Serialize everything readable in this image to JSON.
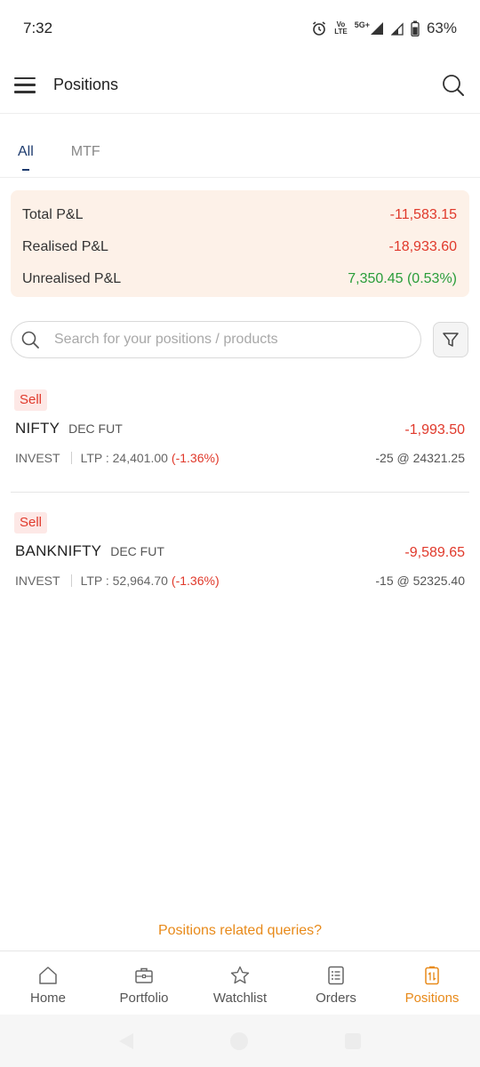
{
  "status_bar": {
    "time": "7:32",
    "network_top": "Vo",
    "network_bottom": "LTE",
    "network_type": "5G+",
    "battery": "63%"
  },
  "header": {
    "title": "Positions"
  },
  "tabs": [
    {
      "label": "All",
      "active": true
    },
    {
      "label": "MTF",
      "active": false
    }
  ],
  "pnl_summary": {
    "total_label": "Total P&L",
    "total_value": "-11,583.15",
    "realised_label": "Realised P&L",
    "realised_value": "-18,933.60",
    "unrealised_label": "Unrealised P&L",
    "unrealised_value": "7,350.45 (0.53%)"
  },
  "search": {
    "placeholder": "Search for your positions / products"
  },
  "positions": [
    {
      "side": "Sell",
      "symbol": "NIFTY",
      "expiry": "DEC FUT",
      "pnl": "-1,993.50",
      "product": "INVEST",
      "ltp": "LTP : 24,401.00",
      "change": "(-1.36%)",
      "qty_price": "-25 @ 24321.25"
    },
    {
      "side": "Sell",
      "symbol": "BANKNIFTY",
      "expiry": "DEC FUT",
      "pnl": "-9,589.65",
      "product": "INVEST",
      "ltp": "LTP : 52,964.70",
      "change": "(-1.36%)",
      "qty_price": "-15 @ 52325.40"
    }
  ],
  "queries_link": "Positions related queries?",
  "bottom_nav": [
    {
      "label": "Home",
      "icon": "home-icon"
    },
    {
      "label": "Portfolio",
      "icon": "briefcase-icon"
    },
    {
      "label": "Watchlist",
      "icon": "star-icon"
    },
    {
      "label": "Orders",
      "icon": "orders-list-icon"
    },
    {
      "label": "Positions",
      "icon": "positions-icon",
      "active": true
    }
  ],
  "colors": {
    "accent": "#e88a1a",
    "negative": "#e0392b",
    "positive": "#2a9d3a",
    "tab_active": "#1d3b6e",
    "pnl_card_bg": "#fdf1e8"
  }
}
